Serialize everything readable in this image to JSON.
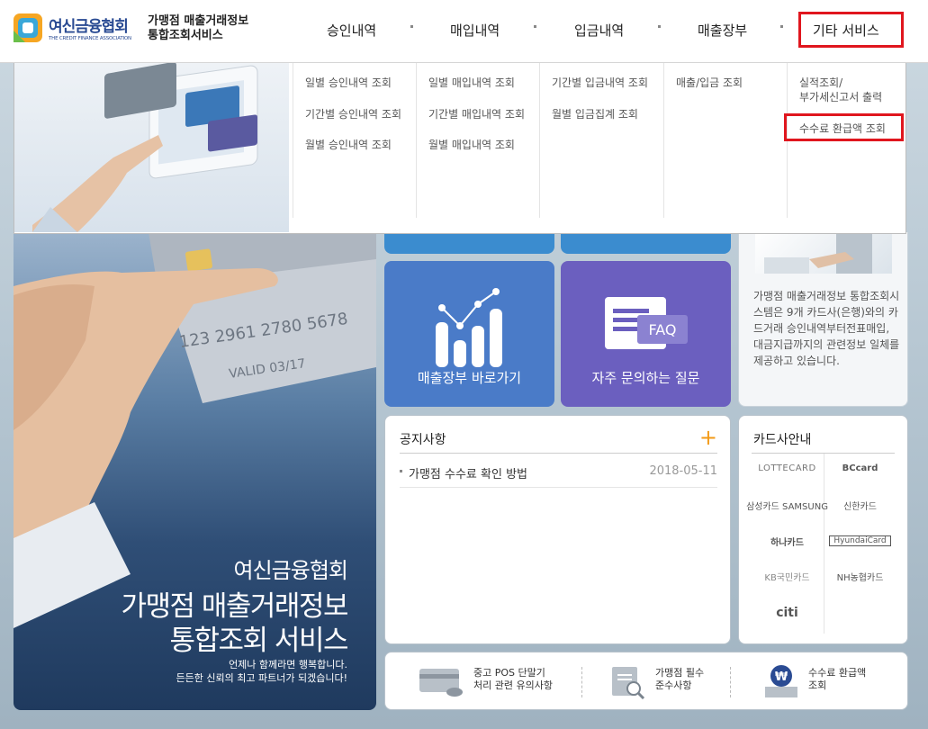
{
  "header": {
    "logo_name": "여신금융협회",
    "logo_english": "THE CREDIT FINANCE ASSOCIATION",
    "site_title_line1": "가맹점 매출거래정보",
    "site_title_line2": "통합조회서비스",
    "nav": [
      {
        "label": "승인내역"
      },
      {
        "label": "매입내역"
      },
      {
        "label": "입금내역"
      },
      {
        "label": "매출장부"
      },
      {
        "label": "기타 서비스",
        "active": true
      }
    ]
  },
  "dropdown": {
    "columns": [
      {
        "items": [
          "일별 승인내역 조회",
          "기간별 승인내역 조회",
          "월별 승인내역 조회"
        ]
      },
      {
        "items": [
          "일별 매입내역 조회",
          "기간별 매입내역 조회",
          "월별 매입내역 조회"
        ]
      },
      {
        "items": [
          "기간별 입금내역 조회",
          "월별 입금집계 조회"
        ]
      },
      {
        "items": [
          "매출/입금 조회"
        ]
      },
      {
        "items": [
          "실적조회/",
          "부가세신고서 출력",
          "수수료 환급액 조회"
        ],
        "highlighted": "수수료 환급액 조회"
      }
    ]
  },
  "hero": {
    "line1": "여신금융협회",
    "line2": "가맹점 매출거래정보",
    "line3": "통합조회 서비스",
    "sub1": "언제나 함께라면 행복합니다.",
    "sub2": "든든한 신뢰의 최고 파트너가 되겠습니다!",
    "card_number": "123 2961 2780 5678",
    "card_valid": "VALID 03/17"
  },
  "quick": {
    "sales_ledger": "매출장부 바로가기",
    "faq": "자주 문의하는 질문",
    "faq_icon_text": "FAQ"
  },
  "info": {
    "text": "가맹점 매출거래정보 통합조회시스템은 9개 카드사(은행)와의 카드거래 승인내역부터전표매입, 대금지급까지의 관련정보 일체를 제공하고 있습니다."
  },
  "notice": {
    "title": "공지사항",
    "more": "+",
    "items": [
      {
        "title": "가맹점 수수료 확인 방법",
        "date": "2018-05-11"
      }
    ]
  },
  "cards": {
    "title": "카드사안내",
    "list": [
      "LOTTECARD",
      "BCcard",
      "삼성카드 SAMSUNG",
      "신한카드",
      "하나카드",
      "HyundaiCard",
      "KB국민카드",
      "NH농협카드",
      "citi"
    ]
  },
  "links": [
    {
      "line1": "중고 POS 단말기",
      "line2": "처리 관련 유의사항"
    },
    {
      "line1": "가맹점 필수",
      "line2": "준수사항"
    },
    {
      "line1": "수수료 환급액",
      "line2": "조회"
    }
  ],
  "colors": {
    "brand": "#2a4b93",
    "highlight": "#e0161e",
    "tile_blue": "#4a7bc8",
    "tile_purple": "#6b5fbf",
    "accent_orange": "#f39a17"
  }
}
